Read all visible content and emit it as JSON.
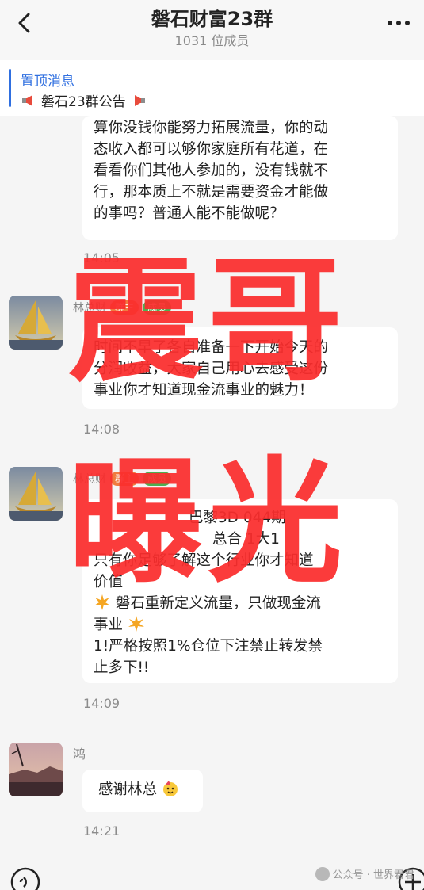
{
  "header": {
    "title": "磐石财富23群",
    "subtitle": "1031 位成员"
  },
  "pinned": {
    "label": "置顶消息",
    "text": "磐石23群公告"
  },
  "messages": [
    {
      "lines": [
        "算你没钱你能努力拓展流量，你的动",
        "态收入都可以够你家庭所有花道，在",
        "看看你们其他人参加的，没有钱就不",
        "行，那本质上不就是需要资金才能做",
        "的事吗？普通人能不能做呢？"
      ],
      "time": "14:05"
    },
    {
      "sender": "林总财",
      "tags": [
        "群主",
        "成员"
      ],
      "lines": [
        "时间不早了各自准备一下开始今天的",
        "分润收益，大家自己用心去感受这份",
        "事业你才知道现金流事业的魅力！"
      ],
      "time": "14:08"
    },
    {
      "sender": "林总财",
      "tags": [
        "群主",
        "成员"
      ],
      "lines": [
        "巴黎3D  044期",
        "总合  1大1",
        "只有你足够了解这个行业你才知道",
        "价值",
        "磐石重新定义流量，只做现金流",
        "事业",
        "1!严格按照1%仓位下注禁止转发禁",
        "止多下!!"
      ],
      "time": "14:09"
    },
    {
      "sender": "鸿",
      "lines": [
        "感谢林总"
      ],
      "time": "14:21"
    }
  ],
  "overlay": {
    "line1": "震哥",
    "line2": "曝光"
  },
  "watermark": "公众号 · 世界君君",
  "colors": {
    "accent": "#2f6fe0",
    "overlay_red": "#fb2d2d",
    "bubble": "#ffffff",
    "background": "#f5f5f5"
  }
}
